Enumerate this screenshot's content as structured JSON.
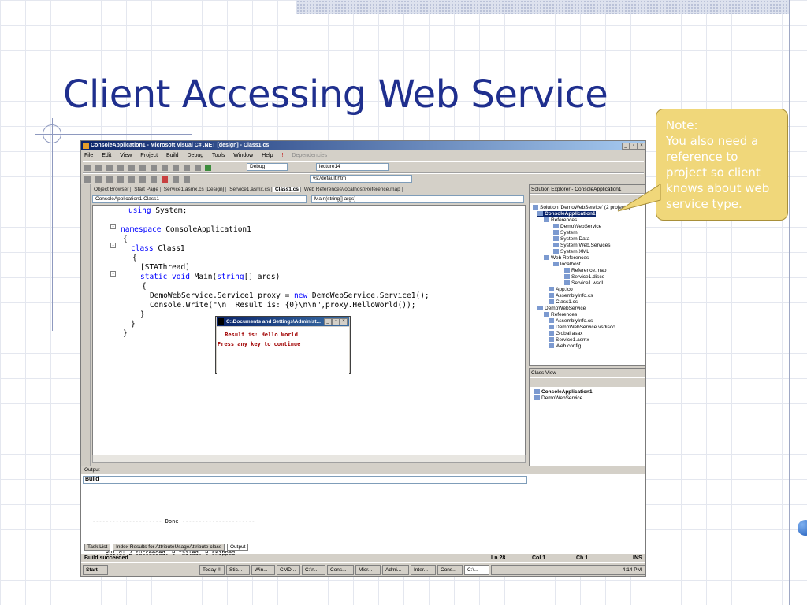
{
  "slide": {
    "title": "Client Accessing Web Service",
    "callout_lines": [
      "Note:",
      "You also need a",
      "reference to",
      "project so client",
      "knows about web",
      "service type."
    ]
  },
  "window": {
    "title": "ConsoleApplication1 - Microsoft Visual C# .NET [design] - Class1.cs",
    "menu": [
      "File",
      "Edit",
      "View",
      "Project",
      "Build",
      "Debug",
      "Tools",
      "Window",
      "Help"
    ],
    "dependencies_label": "Dependencies",
    "config": "Debug",
    "project_combo": "lecture14",
    "url_combo": "vs:/default.htm",
    "doc_tabs": [
      "Object Browser",
      "Start Page",
      "Service1.asmx.cs [Design]",
      "Service1.asmx.cs",
      "Class1.cs",
      "Web References\\localhost\\Reference.map"
    ],
    "editor_class_combo": "ConsoleApplication1.Class1",
    "editor_member_combo": "Main(string[] args)",
    "code": {
      "l1a": "using",
      "l1b": " System;",
      "l2a": "namespace",
      "l2b": " ConsoleApplication1",
      "l3": "{",
      "l4a": "class",
      "l4b": " Class1",
      "l5": "{",
      "l6": "[STAThread]",
      "l7a": "static void",
      "l7b": " Main(",
      "l7c": "string",
      "l7d": "[] args)",
      "l8": "{",
      "l9a": "DemoWebService.Service1 proxy = ",
      "l9b": "new",
      "l9c": " DemoWebService.Service1();",
      "l10": "Console.Write(\"\\n  Result is: {0}\\n\\n\",proxy.HelloWorld());",
      "l11": "}",
      "l12": "}",
      "l13": "}"
    },
    "console": {
      "title": "C:\\Documents and Settings\\Administ...",
      "line1": " Result is: Hello World",
      "line2": "Press any key to continue"
    },
    "solution_explorer": {
      "title": "Solution Explorer - ConsoleApplication1",
      "items": [
        "Solution 'DemoWebService' (2 projects)",
        "ConsoleApplication1",
        "References",
        "DemoWebService",
        "System",
        "System.Data",
        "System.Web.Services",
        "System.XML",
        "Web References",
        "localhost",
        "Reference.map",
        "Service1.disco",
        "Service1.wsdl",
        "App.ico",
        "AssemblyInfo.cs",
        "Class1.cs",
        "DemoWebService",
        "References",
        "AssemblyInfo.cs",
        "DemoWebService.vsdisco",
        "Global.asax",
        "Service1.asmx",
        "Web.config"
      ]
    },
    "class_view": {
      "title": "Class View",
      "items": [
        "ConsoleApplication1",
        "DemoWebService"
      ]
    },
    "output": {
      "title": "Output",
      "combo": "Build",
      "line1": "--------------------- Done ----------------------",
      "line2": "    Build: 2 succeeded, 0 failed, 0 skipped"
    },
    "bottom_tabs": [
      "Task List",
      "Index Results for AttributeUsageAttribute class",
      "Output"
    ],
    "status": {
      "message": "Build succeeded",
      "ln": "Ln 28",
      "col": "Col 1",
      "ch": "Ch 1",
      "ins": "INS"
    },
    "taskbar": {
      "start": "Start",
      "buttons": [
        "Today !!!",
        "Stic...",
        "Win...",
        "CMD...",
        "C:\\n...",
        "Cons...",
        "Micr...",
        "Admi...",
        "Inter...",
        "Cons...",
        "C:\\..."
      ],
      "clock": "4:14 PM"
    }
  }
}
